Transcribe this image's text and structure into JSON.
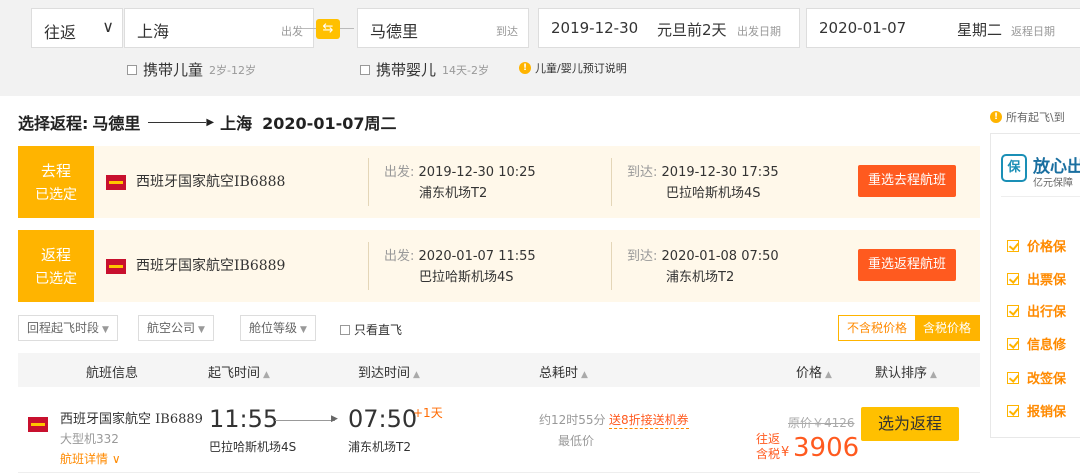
{
  "search": {
    "trip_type": "往返",
    "from_city": "上海",
    "from_tip": "出发",
    "to_city": "马德里",
    "to_tip": "到达",
    "depart_date": "2019-12-30",
    "depart_note": "元旦前2天",
    "depart_tip": "出发日期",
    "return_date": "2020-01-07",
    "return_weekday": "星期二",
    "return_tip": "返程日期",
    "child_label": "携带儿童",
    "child_age": "2岁-12岁",
    "infant_label": "携带婴儿",
    "infant_age": "14天-2岁",
    "booking_info": "儿童/婴儿预订说明"
  },
  "heading": {
    "prefix": "选择返程:",
    "from": "马德里",
    "to": "上海",
    "date": "2020-01-07周二"
  },
  "right_note": "所有起飞\\到",
  "selected": {
    "outbound": {
      "badge1": "去程",
      "badge2": "已选定",
      "airline": "西班牙国家航空IB6888",
      "dep_key": "出发:",
      "dep_time": "2019-12-30 10:25",
      "dep_airport": "浦东机场T2",
      "arr_key": "到达:",
      "arr_time": "2019-12-30 17:35",
      "arr_airport": "巴拉哈斯机场4S",
      "button": "重选去程航班"
    },
    "return": {
      "badge1": "返程",
      "badge2": "已选定",
      "airline": "西班牙国家航空IB6889",
      "dep_key": "出发:",
      "dep_time": "2020-01-07 11:55",
      "dep_airport": "巴拉哈斯机场4S",
      "arr_key": "到达:",
      "arr_time": "2020-01-08 07:50",
      "arr_airport": "浦东机场T2",
      "button": "重选返程航班"
    }
  },
  "filters": {
    "time": "回程起飞时段",
    "airline": "航空公司",
    "cabin": "舱位等级",
    "direct": "只看直飞",
    "price_excl_tax": "不含税价格",
    "price_incl_tax": "含税价格"
  },
  "table_header": {
    "info": "航班信息",
    "dep": "起飞时间",
    "arr": "到达时间",
    "duration": "总耗时",
    "price": "价格",
    "sort": "默认排序"
  },
  "flight": {
    "name": "西班牙国家航空 IB6889",
    "plane": "大型机332",
    "detail": "航班详情",
    "dep_time": "11:55",
    "dep_airport": "巴拉哈斯机场4S",
    "arr_time": "07:50",
    "arr_plus": "+1天",
    "arr_airport": "浦东机场T2",
    "duration": "约12时55分",
    "lowest": "最低价",
    "coupon": "送8折接送机券",
    "orig_price": "原价￥4126",
    "price_type1": "往返",
    "price_type2": "含税",
    "currency": "¥",
    "price": "3906",
    "button": "选为返程"
  },
  "sidebar": {
    "logo": "保",
    "title": "放心出",
    "subtitle": "亿元保障",
    "items": [
      "价格保",
      "出票保",
      "出行保",
      "信息修",
      "改签保",
      "报销保"
    ]
  }
}
